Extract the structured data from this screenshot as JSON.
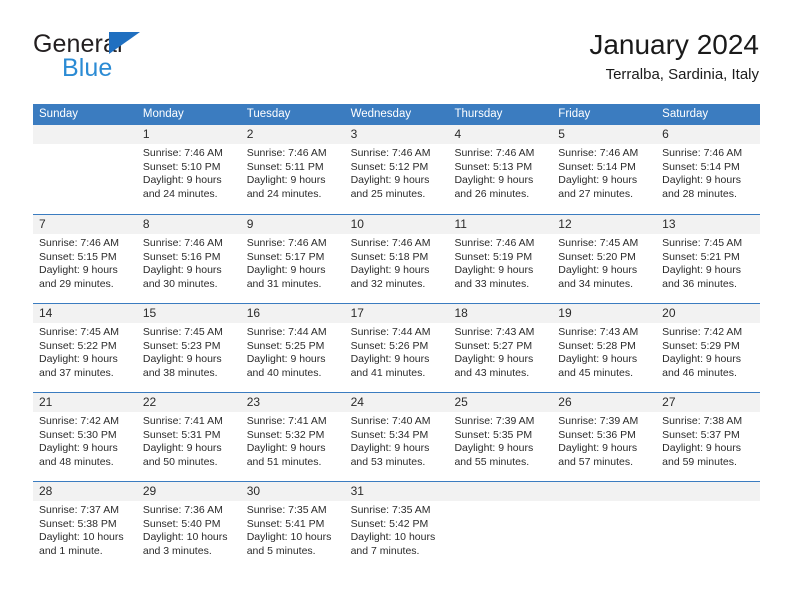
{
  "brand": {
    "name_part1": "General",
    "name_part2": "Blue",
    "accent_color": "#2b8bd4",
    "triangle_color": "#1f6fc0"
  },
  "header": {
    "title": "January 2024",
    "subtitle": "Terralba, Sardinia, Italy",
    "header_bg_color": "#3b7cc0",
    "daynum_band_color": "#f2f2f2"
  },
  "weekdays": [
    "Sunday",
    "Monday",
    "Tuesday",
    "Wednesday",
    "Thursday",
    "Friday",
    "Saturday"
  ],
  "weeks": [
    {
      "days": [
        {
          "num": "",
          "sunrise": "",
          "sunset": "",
          "daylight_1": "",
          "daylight_2": "",
          "empty": true
        },
        {
          "num": "1",
          "sunrise": "Sunrise: 7:46 AM",
          "sunset": "Sunset: 5:10 PM",
          "daylight_1": "Daylight: 9 hours",
          "daylight_2": "and 24 minutes."
        },
        {
          "num": "2",
          "sunrise": "Sunrise: 7:46 AM",
          "sunset": "Sunset: 5:11 PM",
          "daylight_1": "Daylight: 9 hours",
          "daylight_2": "and 24 minutes."
        },
        {
          "num": "3",
          "sunrise": "Sunrise: 7:46 AM",
          "sunset": "Sunset: 5:12 PM",
          "daylight_1": "Daylight: 9 hours",
          "daylight_2": "and 25 minutes."
        },
        {
          "num": "4",
          "sunrise": "Sunrise: 7:46 AM",
          "sunset": "Sunset: 5:13 PM",
          "daylight_1": "Daylight: 9 hours",
          "daylight_2": "and 26 minutes."
        },
        {
          "num": "5",
          "sunrise": "Sunrise: 7:46 AM",
          "sunset": "Sunset: 5:14 PM",
          "daylight_1": "Daylight: 9 hours",
          "daylight_2": "and 27 minutes."
        },
        {
          "num": "6",
          "sunrise": "Sunrise: 7:46 AM",
          "sunset": "Sunset: 5:14 PM",
          "daylight_1": "Daylight: 9 hours",
          "daylight_2": "and 28 minutes."
        }
      ]
    },
    {
      "days": [
        {
          "num": "7",
          "sunrise": "Sunrise: 7:46 AM",
          "sunset": "Sunset: 5:15 PM",
          "daylight_1": "Daylight: 9 hours",
          "daylight_2": "and 29 minutes."
        },
        {
          "num": "8",
          "sunrise": "Sunrise: 7:46 AM",
          "sunset": "Sunset: 5:16 PM",
          "daylight_1": "Daylight: 9 hours",
          "daylight_2": "and 30 minutes."
        },
        {
          "num": "9",
          "sunrise": "Sunrise: 7:46 AM",
          "sunset": "Sunset: 5:17 PM",
          "daylight_1": "Daylight: 9 hours",
          "daylight_2": "and 31 minutes."
        },
        {
          "num": "10",
          "sunrise": "Sunrise: 7:46 AM",
          "sunset": "Sunset: 5:18 PM",
          "daylight_1": "Daylight: 9 hours",
          "daylight_2": "and 32 minutes."
        },
        {
          "num": "11",
          "sunrise": "Sunrise: 7:46 AM",
          "sunset": "Sunset: 5:19 PM",
          "daylight_1": "Daylight: 9 hours",
          "daylight_2": "and 33 minutes."
        },
        {
          "num": "12",
          "sunrise": "Sunrise: 7:45 AM",
          "sunset": "Sunset: 5:20 PM",
          "daylight_1": "Daylight: 9 hours",
          "daylight_2": "and 34 minutes."
        },
        {
          "num": "13",
          "sunrise": "Sunrise: 7:45 AM",
          "sunset": "Sunset: 5:21 PM",
          "daylight_1": "Daylight: 9 hours",
          "daylight_2": "and 36 minutes."
        }
      ]
    },
    {
      "days": [
        {
          "num": "14",
          "sunrise": "Sunrise: 7:45 AM",
          "sunset": "Sunset: 5:22 PM",
          "daylight_1": "Daylight: 9 hours",
          "daylight_2": "and 37 minutes."
        },
        {
          "num": "15",
          "sunrise": "Sunrise: 7:45 AM",
          "sunset": "Sunset: 5:23 PM",
          "daylight_1": "Daylight: 9 hours",
          "daylight_2": "and 38 minutes."
        },
        {
          "num": "16",
          "sunrise": "Sunrise: 7:44 AM",
          "sunset": "Sunset: 5:25 PM",
          "daylight_1": "Daylight: 9 hours",
          "daylight_2": "and 40 minutes."
        },
        {
          "num": "17",
          "sunrise": "Sunrise: 7:44 AM",
          "sunset": "Sunset: 5:26 PM",
          "daylight_1": "Daylight: 9 hours",
          "daylight_2": "and 41 minutes."
        },
        {
          "num": "18",
          "sunrise": "Sunrise: 7:43 AM",
          "sunset": "Sunset: 5:27 PM",
          "daylight_1": "Daylight: 9 hours",
          "daylight_2": "and 43 minutes."
        },
        {
          "num": "19",
          "sunrise": "Sunrise: 7:43 AM",
          "sunset": "Sunset: 5:28 PM",
          "daylight_1": "Daylight: 9 hours",
          "daylight_2": "and 45 minutes."
        },
        {
          "num": "20",
          "sunrise": "Sunrise: 7:42 AM",
          "sunset": "Sunset: 5:29 PM",
          "daylight_1": "Daylight: 9 hours",
          "daylight_2": "and 46 minutes."
        }
      ]
    },
    {
      "days": [
        {
          "num": "21",
          "sunrise": "Sunrise: 7:42 AM",
          "sunset": "Sunset: 5:30 PM",
          "daylight_1": "Daylight: 9 hours",
          "daylight_2": "and 48 minutes."
        },
        {
          "num": "22",
          "sunrise": "Sunrise: 7:41 AM",
          "sunset": "Sunset: 5:31 PM",
          "daylight_1": "Daylight: 9 hours",
          "daylight_2": "and 50 minutes."
        },
        {
          "num": "23",
          "sunrise": "Sunrise: 7:41 AM",
          "sunset": "Sunset: 5:32 PM",
          "daylight_1": "Daylight: 9 hours",
          "daylight_2": "and 51 minutes."
        },
        {
          "num": "24",
          "sunrise": "Sunrise: 7:40 AM",
          "sunset": "Sunset: 5:34 PM",
          "daylight_1": "Daylight: 9 hours",
          "daylight_2": "and 53 minutes."
        },
        {
          "num": "25",
          "sunrise": "Sunrise: 7:39 AM",
          "sunset": "Sunset: 5:35 PM",
          "daylight_1": "Daylight: 9 hours",
          "daylight_2": "and 55 minutes."
        },
        {
          "num": "26",
          "sunrise": "Sunrise: 7:39 AM",
          "sunset": "Sunset: 5:36 PM",
          "daylight_1": "Daylight: 9 hours",
          "daylight_2": "and 57 minutes."
        },
        {
          "num": "27",
          "sunrise": "Sunrise: 7:38 AM",
          "sunset": "Sunset: 5:37 PM",
          "daylight_1": "Daylight: 9 hours",
          "daylight_2": "and 59 minutes."
        }
      ]
    },
    {
      "days": [
        {
          "num": "28",
          "sunrise": "Sunrise: 7:37 AM",
          "sunset": "Sunset: 5:38 PM",
          "daylight_1": "Daylight: 10 hours",
          "daylight_2": "and 1 minute."
        },
        {
          "num": "29",
          "sunrise": "Sunrise: 7:36 AM",
          "sunset": "Sunset: 5:40 PM",
          "daylight_1": "Daylight: 10 hours",
          "daylight_2": "and 3 minutes."
        },
        {
          "num": "30",
          "sunrise": "Sunrise: 7:35 AM",
          "sunset": "Sunset: 5:41 PM",
          "daylight_1": "Daylight: 10 hours",
          "daylight_2": "and 5 minutes."
        },
        {
          "num": "31",
          "sunrise": "Sunrise: 7:35 AM",
          "sunset": "Sunset: 5:42 PM",
          "daylight_1": "Daylight: 10 hours",
          "daylight_2": "and 7 minutes."
        },
        {
          "num": "",
          "sunrise": "",
          "sunset": "",
          "daylight_1": "",
          "daylight_2": "",
          "empty": true
        },
        {
          "num": "",
          "sunrise": "",
          "sunset": "",
          "daylight_1": "",
          "daylight_2": "",
          "empty": true
        },
        {
          "num": "",
          "sunrise": "",
          "sunset": "",
          "daylight_1": "",
          "daylight_2": "",
          "empty": true
        }
      ]
    }
  ]
}
